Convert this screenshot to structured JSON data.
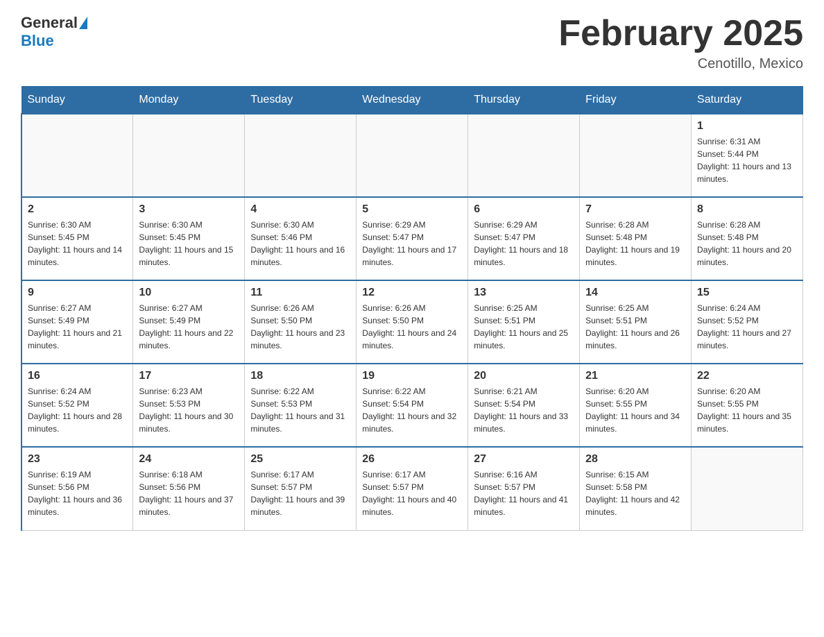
{
  "header": {
    "logo_general": "General",
    "logo_blue": "Blue",
    "title": "February 2025",
    "subtitle": "Cenotillo, Mexico"
  },
  "days_of_week": [
    "Sunday",
    "Monday",
    "Tuesday",
    "Wednesday",
    "Thursday",
    "Friday",
    "Saturday"
  ],
  "weeks": [
    [
      {
        "day": "",
        "info": ""
      },
      {
        "day": "",
        "info": ""
      },
      {
        "day": "",
        "info": ""
      },
      {
        "day": "",
        "info": ""
      },
      {
        "day": "",
        "info": ""
      },
      {
        "day": "",
        "info": ""
      },
      {
        "day": "1",
        "info": "Sunrise: 6:31 AM\nSunset: 5:44 PM\nDaylight: 11 hours and 13 minutes."
      }
    ],
    [
      {
        "day": "2",
        "info": "Sunrise: 6:30 AM\nSunset: 5:45 PM\nDaylight: 11 hours and 14 minutes."
      },
      {
        "day": "3",
        "info": "Sunrise: 6:30 AM\nSunset: 5:45 PM\nDaylight: 11 hours and 15 minutes."
      },
      {
        "day": "4",
        "info": "Sunrise: 6:30 AM\nSunset: 5:46 PM\nDaylight: 11 hours and 16 minutes."
      },
      {
        "day": "5",
        "info": "Sunrise: 6:29 AM\nSunset: 5:47 PM\nDaylight: 11 hours and 17 minutes."
      },
      {
        "day": "6",
        "info": "Sunrise: 6:29 AM\nSunset: 5:47 PM\nDaylight: 11 hours and 18 minutes."
      },
      {
        "day": "7",
        "info": "Sunrise: 6:28 AM\nSunset: 5:48 PM\nDaylight: 11 hours and 19 minutes."
      },
      {
        "day": "8",
        "info": "Sunrise: 6:28 AM\nSunset: 5:48 PM\nDaylight: 11 hours and 20 minutes."
      }
    ],
    [
      {
        "day": "9",
        "info": "Sunrise: 6:27 AM\nSunset: 5:49 PM\nDaylight: 11 hours and 21 minutes."
      },
      {
        "day": "10",
        "info": "Sunrise: 6:27 AM\nSunset: 5:49 PM\nDaylight: 11 hours and 22 minutes."
      },
      {
        "day": "11",
        "info": "Sunrise: 6:26 AM\nSunset: 5:50 PM\nDaylight: 11 hours and 23 minutes."
      },
      {
        "day": "12",
        "info": "Sunrise: 6:26 AM\nSunset: 5:50 PM\nDaylight: 11 hours and 24 minutes."
      },
      {
        "day": "13",
        "info": "Sunrise: 6:25 AM\nSunset: 5:51 PM\nDaylight: 11 hours and 25 minutes."
      },
      {
        "day": "14",
        "info": "Sunrise: 6:25 AM\nSunset: 5:51 PM\nDaylight: 11 hours and 26 minutes."
      },
      {
        "day": "15",
        "info": "Sunrise: 6:24 AM\nSunset: 5:52 PM\nDaylight: 11 hours and 27 minutes."
      }
    ],
    [
      {
        "day": "16",
        "info": "Sunrise: 6:24 AM\nSunset: 5:52 PM\nDaylight: 11 hours and 28 minutes."
      },
      {
        "day": "17",
        "info": "Sunrise: 6:23 AM\nSunset: 5:53 PM\nDaylight: 11 hours and 30 minutes."
      },
      {
        "day": "18",
        "info": "Sunrise: 6:22 AM\nSunset: 5:53 PM\nDaylight: 11 hours and 31 minutes."
      },
      {
        "day": "19",
        "info": "Sunrise: 6:22 AM\nSunset: 5:54 PM\nDaylight: 11 hours and 32 minutes."
      },
      {
        "day": "20",
        "info": "Sunrise: 6:21 AM\nSunset: 5:54 PM\nDaylight: 11 hours and 33 minutes."
      },
      {
        "day": "21",
        "info": "Sunrise: 6:20 AM\nSunset: 5:55 PM\nDaylight: 11 hours and 34 minutes."
      },
      {
        "day": "22",
        "info": "Sunrise: 6:20 AM\nSunset: 5:55 PM\nDaylight: 11 hours and 35 minutes."
      }
    ],
    [
      {
        "day": "23",
        "info": "Sunrise: 6:19 AM\nSunset: 5:56 PM\nDaylight: 11 hours and 36 minutes."
      },
      {
        "day": "24",
        "info": "Sunrise: 6:18 AM\nSunset: 5:56 PM\nDaylight: 11 hours and 37 minutes."
      },
      {
        "day": "25",
        "info": "Sunrise: 6:17 AM\nSunset: 5:57 PM\nDaylight: 11 hours and 39 minutes."
      },
      {
        "day": "26",
        "info": "Sunrise: 6:17 AM\nSunset: 5:57 PM\nDaylight: 11 hours and 40 minutes."
      },
      {
        "day": "27",
        "info": "Sunrise: 6:16 AM\nSunset: 5:57 PM\nDaylight: 11 hours and 41 minutes."
      },
      {
        "day": "28",
        "info": "Sunrise: 6:15 AM\nSunset: 5:58 PM\nDaylight: 11 hours and 42 minutes."
      },
      {
        "day": "",
        "info": ""
      }
    ]
  ]
}
